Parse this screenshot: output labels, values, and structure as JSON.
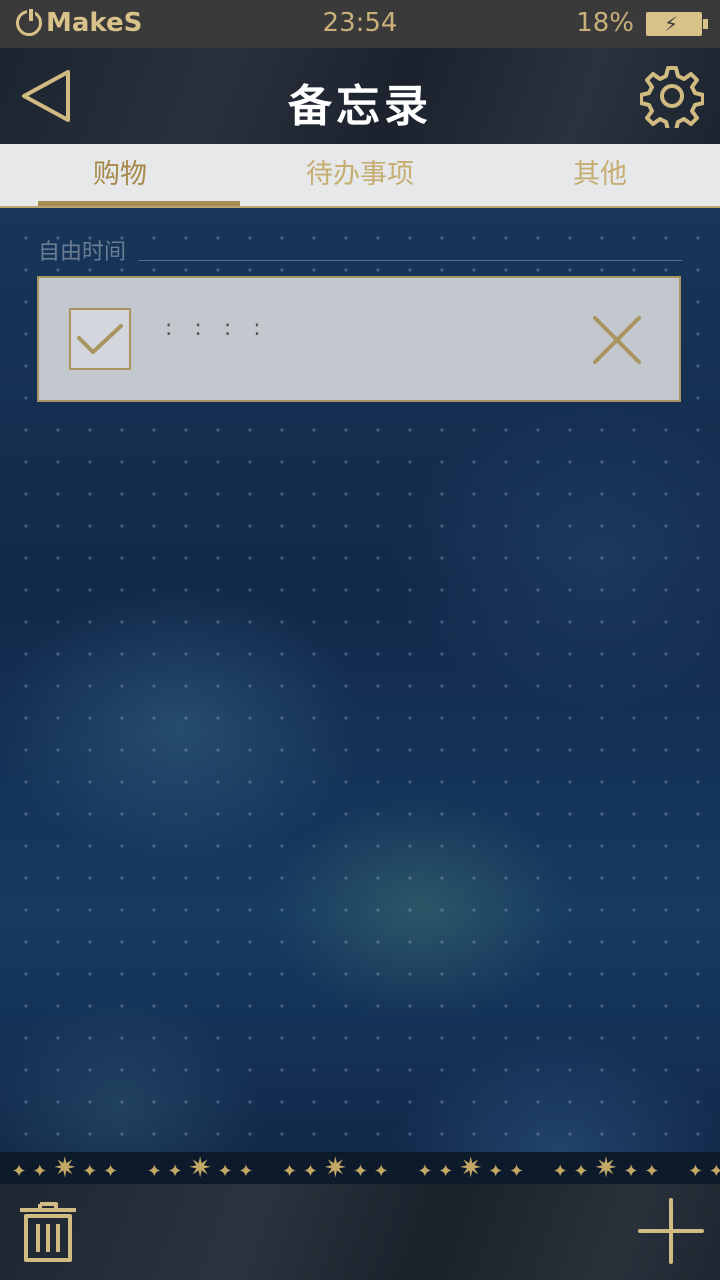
{
  "status_bar": {
    "brand": "MakeS",
    "time": "23:54",
    "battery": "18%"
  },
  "header": {
    "title": "备忘录"
  },
  "tabs": [
    {
      "label": "购物",
      "active": true
    },
    {
      "label": "待办事项",
      "active": false
    },
    {
      "label": "其他",
      "active": false
    }
  ],
  "section": {
    "label": "自由时间"
  },
  "memo": {
    "text": "::::",
    "checked": true
  },
  "colors": {
    "accent": "#a89561",
    "tab_text": "#c6ad72",
    "card_bg": "#c3c7ce",
    "header_bg": "#242b35"
  },
  "icons": {
    "back": "back-triangle-icon",
    "settings": "gear-icon",
    "check": "checkmark-icon",
    "delete": "close-icon",
    "trash": "trash-icon",
    "add": "plus-icon",
    "power": "power-icon",
    "battery": "battery-charging-icon"
  }
}
